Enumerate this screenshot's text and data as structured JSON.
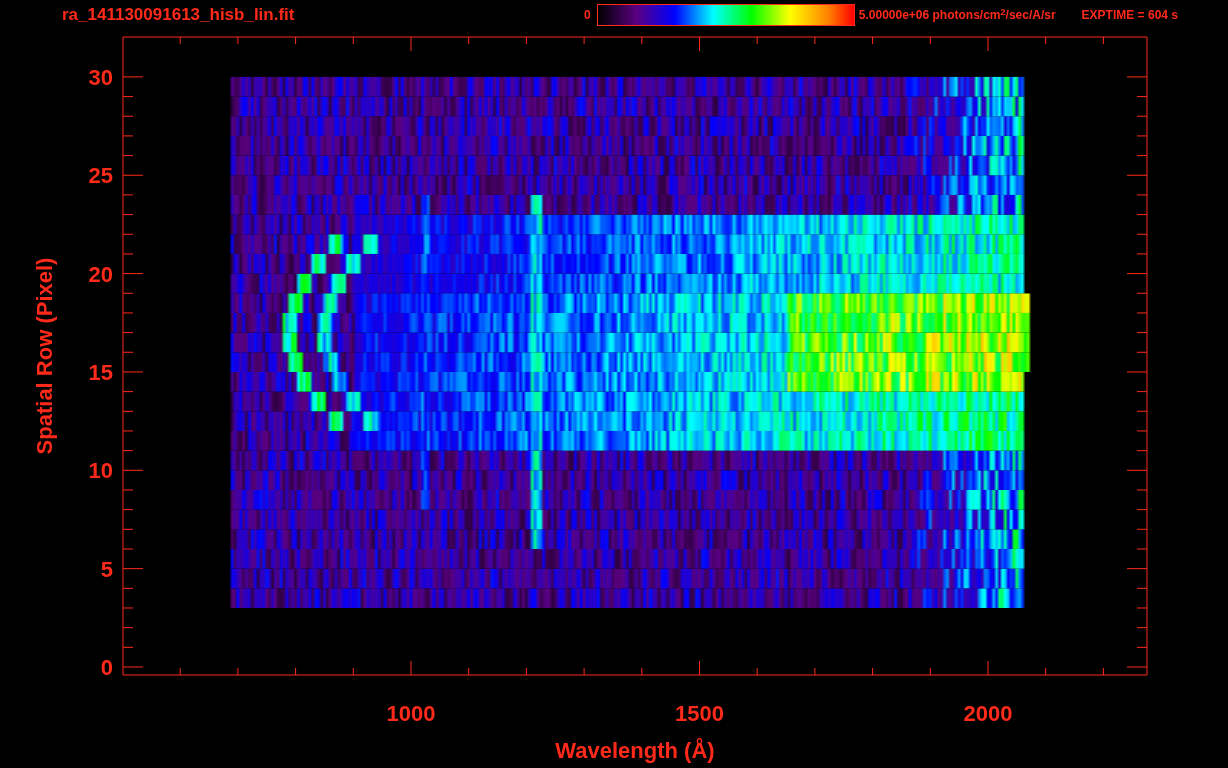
{
  "title": "ra_141130091613_hisb_lin.fit",
  "colorbar": {
    "min_label": "0",
    "max_label": "5.00000e+06 photons/cm$^{2}$/sec/A/sr"
  },
  "exposure": "EXPTIME = 604 s",
  "plot": {
    "xlabel": "Wavelength (Å)",
    "ylabel": "Spatial Row (Pixel)",
    "xticks": [
      "1000",
      "1500",
      "2000"
    ],
    "yticks": [
      "30",
      "25",
      "20",
      "15",
      "10",
      "5",
      "0"
    ]
  }
}
